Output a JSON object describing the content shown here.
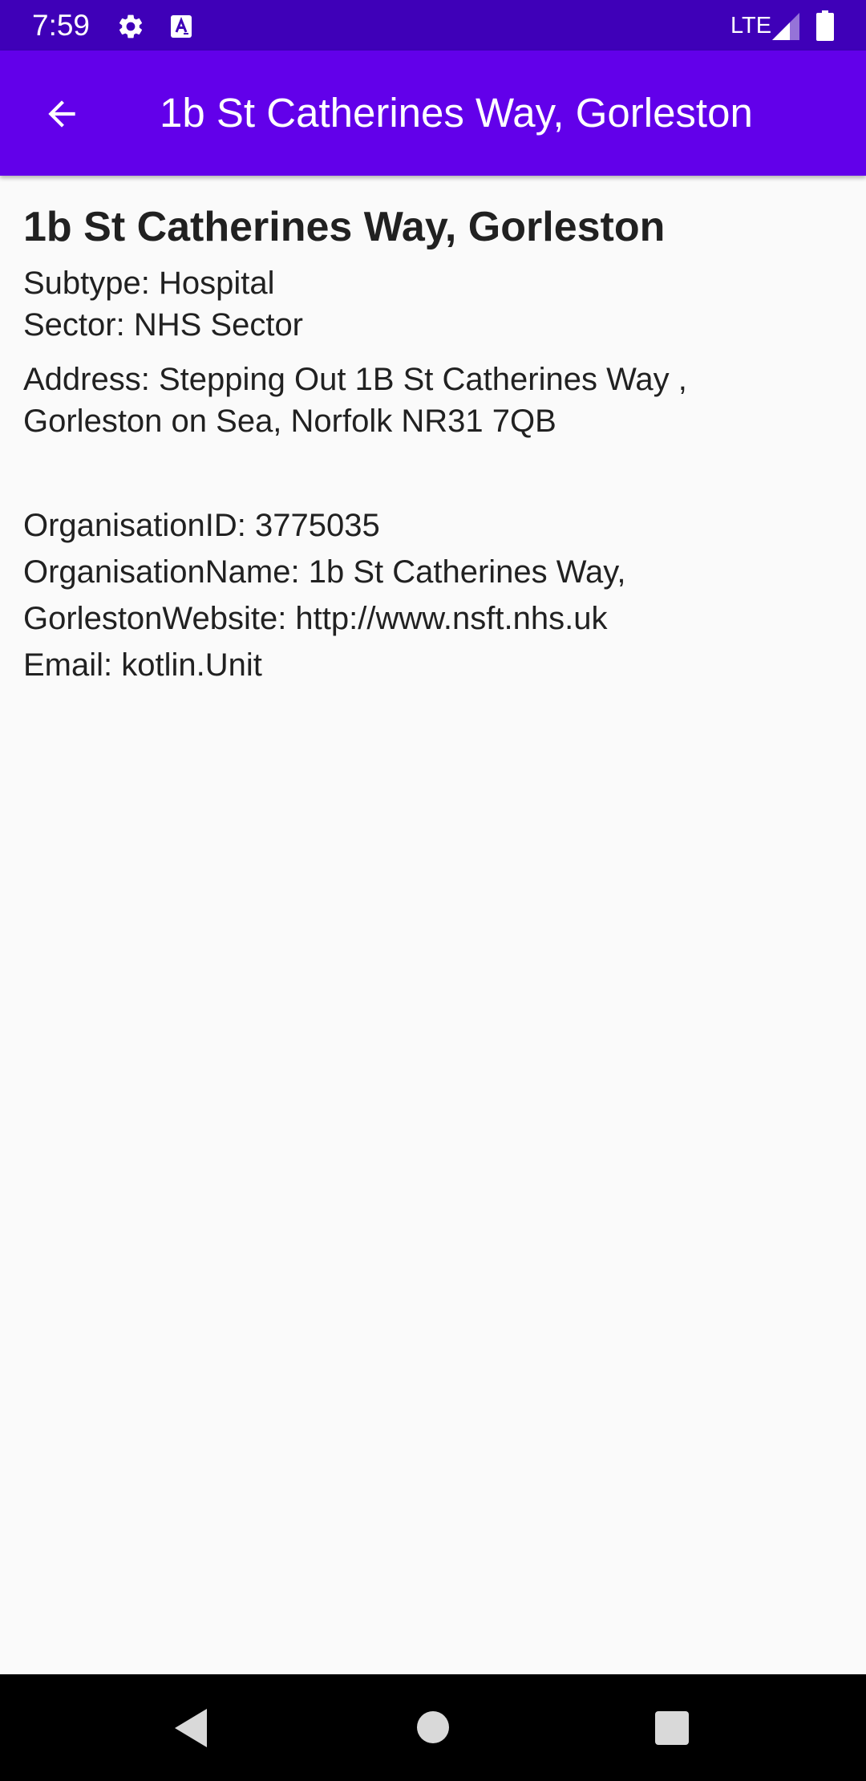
{
  "status_bar": {
    "time": "7:59",
    "network": "LTE",
    "icons": [
      "gear-icon",
      "text-a-icon",
      "signal-icon",
      "battery-icon"
    ],
    "background": "#3f00b8"
  },
  "app_bar": {
    "title": "1b St Catherines Way, Gorleston",
    "back_icon": "arrow-left-icon",
    "background": "#6200ea"
  },
  "detail": {
    "heading": "1b St Catherines Way, Gorleston",
    "subtype": "Subtype: Hospital",
    "sector": "Sector: NHS Sector",
    "address_line1": "Address: Stepping Out 1B St Catherines Way ,",
    "address_line2": "Gorleston on Sea, Norfolk NR31 7QB",
    "organisation_id": "OrganisationID: 3775035",
    "organisation_name_line1": "OrganisationName: 1b St Catherines Way,",
    "organisation_name_line2": "GorlestonWebsite: http://www.nsft.nhs.uk",
    "email": "Email:  kotlin.Unit"
  },
  "nav_bar": {
    "icons": [
      "nav-back-icon",
      "nav-home-icon",
      "nav-recents-icon"
    ]
  }
}
